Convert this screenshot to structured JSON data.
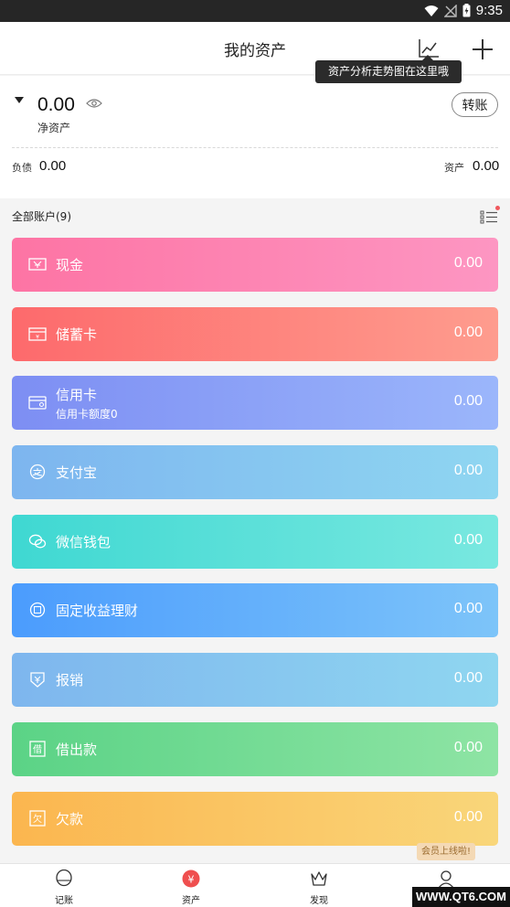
{
  "status_bar": {
    "time": "9:35"
  },
  "header": {
    "title": "我的资产"
  },
  "tooltip": {
    "text": "资产分析走势图在这里哦"
  },
  "summary": {
    "net_value": "0.00",
    "net_label": "净资产",
    "transfer_label": "转账",
    "debt_label": "负债",
    "debt_value": "0.00",
    "asset_label": "资产",
    "asset_value": "0.00"
  },
  "accounts_header": "全部账户(9)",
  "accounts": [
    {
      "name": "现金",
      "value": "0.00",
      "icon": "cash-icon",
      "gradient": [
        "#fd74a4",
        "#fd96c2"
      ]
    },
    {
      "name": "储蓄卡",
      "value": "0.00",
      "icon": "savings-card-icon",
      "gradient": [
        "#fd6a6c",
        "#fe9c8e"
      ]
    },
    {
      "name": "信用卡",
      "sub": "信用卡额度0",
      "value": "0.00",
      "icon": "credit-card-icon",
      "gradient": [
        "#7d8ef3",
        "#9bb6fb"
      ]
    },
    {
      "name": "支付宝",
      "value": "0.00",
      "icon": "alipay-icon",
      "gradient": [
        "#7db5ef",
        "#8fd6f1"
      ]
    },
    {
      "name": "微信钱包",
      "value": "0.00",
      "icon": "wechat-icon",
      "gradient": [
        "#3fd8d2",
        "#79e8e0"
      ]
    },
    {
      "name": "固定收益理财",
      "value": "0.00",
      "icon": "fixed-income-icon",
      "gradient": [
        "#4b9cfd",
        "#7dc4f9"
      ]
    },
    {
      "name": "报销",
      "value": "0.00",
      "icon": "reimburse-icon",
      "gradient": [
        "#7eb6ee",
        "#8fd6f0"
      ]
    },
    {
      "name": "借出款",
      "value": "0.00",
      "icon": "loan-out-icon",
      "gradient": [
        "#5bd386",
        "#8ee4a4"
      ]
    },
    {
      "name": "欠款",
      "value": "0.00",
      "icon": "debt-icon",
      "gradient": [
        "#fbb64f",
        "#f9d67a"
      ]
    }
  ],
  "bottom_nav": [
    {
      "label": "记账",
      "icon": "bookkeeping-icon"
    },
    {
      "label": "资产",
      "icon": "assets-icon",
      "active": true
    },
    {
      "label": "发现",
      "icon": "discover-icon"
    },
    {
      "label": "",
      "icon": "profile-icon"
    }
  ],
  "member_badge": "会员上线啦!",
  "watermark": "WWW.QT6.COM",
  "colors": {
    "accent": "#ef4f4f"
  }
}
